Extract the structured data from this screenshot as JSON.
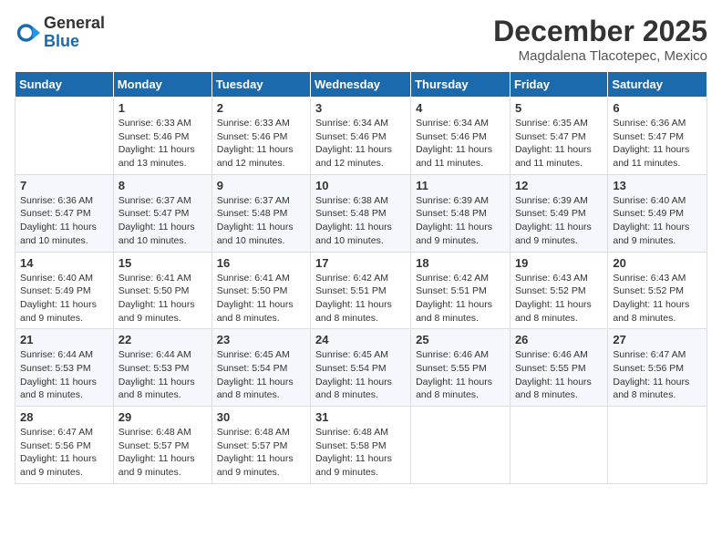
{
  "header": {
    "logo": {
      "general": "General",
      "blue": "Blue"
    },
    "month_title": "December 2025",
    "subtitle": "Magdalena Tlacotepec, Mexico"
  },
  "calendar": {
    "days_of_week": [
      "Sunday",
      "Monday",
      "Tuesday",
      "Wednesday",
      "Thursday",
      "Friday",
      "Saturday"
    ],
    "weeks": [
      [
        {
          "day": "",
          "info": ""
        },
        {
          "day": "1",
          "info": "Sunrise: 6:33 AM\nSunset: 5:46 PM\nDaylight: 11 hours\nand 13 minutes."
        },
        {
          "day": "2",
          "info": "Sunrise: 6:33 AM\nSunset: 5:46 PM\nDaylight: 11 hours\nand 12 minutes."
        },
        {
          "day": "3",
          "info": "Sunrise: 6:34 AM\nSunset: 5:46 PM\nDaylight: 11 hours\nand 12 minutes."
        },
        {
          "day": "4",
          "info": "Sunrise: 6:34 AM\nSunset: 5:46 PM\nDaylight: 11 hours\nand 11 minutes."
        },
        {
          "day": "5",
          "info": "Sunrise: 6:35 AM\nSunset: 5:47 PM\nDaylight: 11 hours\nand 11 minutes."
        },
        {
          "day": "6",
          "info": "Sunrise: 6:36 AM\nSunset: 5:47 PM\nDaylight: 11 hours\nand 11 minutes."
        }
      ],
      [
        {
          "day": "7",
          "info": "Sunrise: 6:36 AM\nSunset: 5:47 PM\nDaylight: 11 hours\nand 10 minutes."
        },
        {
          "day": "8",
          "info": "Sunrise: 6:37 AM\nSunset: 5:47 PM\nDaylight: 11 hours\nand 10 minutes."
        },
        {
          "day": "9",
          "info": "Sunrise: 6:37 AM\nSunset: 5:48 PM\nDaylight: 11 hours\nand 10 minutes."
        },
        {
          "day": "10",
          "info": "Sunrise: 6:38 AM\nSunset: 5:48 PM\nDaylight: 11 hours\nand 10 minutes."
        },
        {
          "day": "11",
          "info": "Sunrise: 6:39 AM\nSunset: 5:48 PM\nDaylight: 11 hours\nand 9 minutes."
        },
        {
          "day": "12",
          "info": "Sunrise: 6:39 AM\nSunset: 5:49 PM\nDaylight: 11 hours\nand 9 minutes."
        },
        {
          "day": "13",
          "info": "Sunrise: 6:40 AM\nSunset: 5:49 PM\nDaylight: 11 hours\nand 9 minutes."
        }
      ],
      [
        {
          "day": "14",
          "info": "Sunrise: 6:40 AM\nSunset: 5:49 PM\nDaylight: 11 hours\nand 9 minutes."
        },
        {
          "day": "15",
          "info": "Sunrise: 6:41 AM\nSunset: 5:50 PM\nDaylight: 11 hours\nand 9 minutes."
        },
        {
          "day": "16",
          "info": "Sunrise: 6:41 AM\nSunset: 5:50 PM\nDaylight: 11 hours\nand 8 minutes."
        },
        {
          "day": "17",
          "info": "Sunrise: 6:42 AM\nSunset: 5:51 PM\nDaylight: 11 hours\nand 8 minutes."
        },
        {
          "day": "18",
          "info": "Sunrise: 6:42 AM\nSunset: 5:51 PM\nDaylight: 11 hours\nand 8 minutes."
        },
        {
          "day": "19",
          "info": "Sunrise: 6:43 AM\nSunset: 5:52 PM\nDaylight: 11 hours\nand 8 minutes."
        },
        {
          "day": "20",
          "info": "Sunrise: 6:43 AM\nSunset: 5:52 PM\nDaylight: 11 hours\nand 8 minutes."
        }
      ],
      [
        {
          "day": "21",
          "info": "Sunrise: 6:44 AM\nSunset: 5:53 PM\nDaylight: 11 hours\nand 8 minutes."
        },
        {
          "day": "22",
          "info": "Sunrise: 6:44 AM\nSunset: 5:53 PM\nDaylight: 11 hours\nand 8 minutes."
        },
        {
          "day": "23",
          "info": "Sunrise: 6:45 AM\nSunset: 5:54 PM\nDaylight: 11 hours\nand 8 minutes."
        },
        {
          "day": "24",
          "info": "Sunrise: 6:45 AM\nSunset: 5:54 PM\nDaylight: 11 hours\nand 8 minutes."
        },
        {
          "day": "25",
          "info": "Sunrise: 6:46 AM\nSunset: 5:55 PM\nDaylight: 11 hours\nand 8 minutes."
        },
        {
          "day": "26",
          "info": "Sunrise: 6:46 AM\nSunset: 5:55 PM\nDaylight: 11 hours\nand 8 minutes."
        },
        {
          "day": "27",
          "info": "Sunrise: 6:47 AM\nSunset: 5:56 PM\nDaylight: 11 hours\nand 8 minutes."
        }
      ],
      [
        {
          "day": "28",
          "info": "Sunrise: 6:47 AM\nSunset: 5:56 PM\nDaylight: 11 hours\nand 9 minutes."
        },
        {
          "day": "29",
          "info": "Sunrise: 6:48 AM\nSunset: 5:57 PM\nDaylight: 11 hours\nand 9 minutes."
        },
        {
          "day": "30",
          "info": "Sunrise: 6:48 AM\nSunset: 5:57 PM\nDaylight: 11 hours\nand 9 minutes."
        },
        {
          "day": "31",
          "info": "Sunrise: 6:48 AM\nSunset: 5:58 PM\nDaylight: 11 hours\nand 9 minutes."
        },
        {
          "day": "",
          "info": ""
        },
        {
          "day": "",
          "info": ""
        },
        {
          "day": "",
          "info": ""
        }
      ]
    ]
  }
}
